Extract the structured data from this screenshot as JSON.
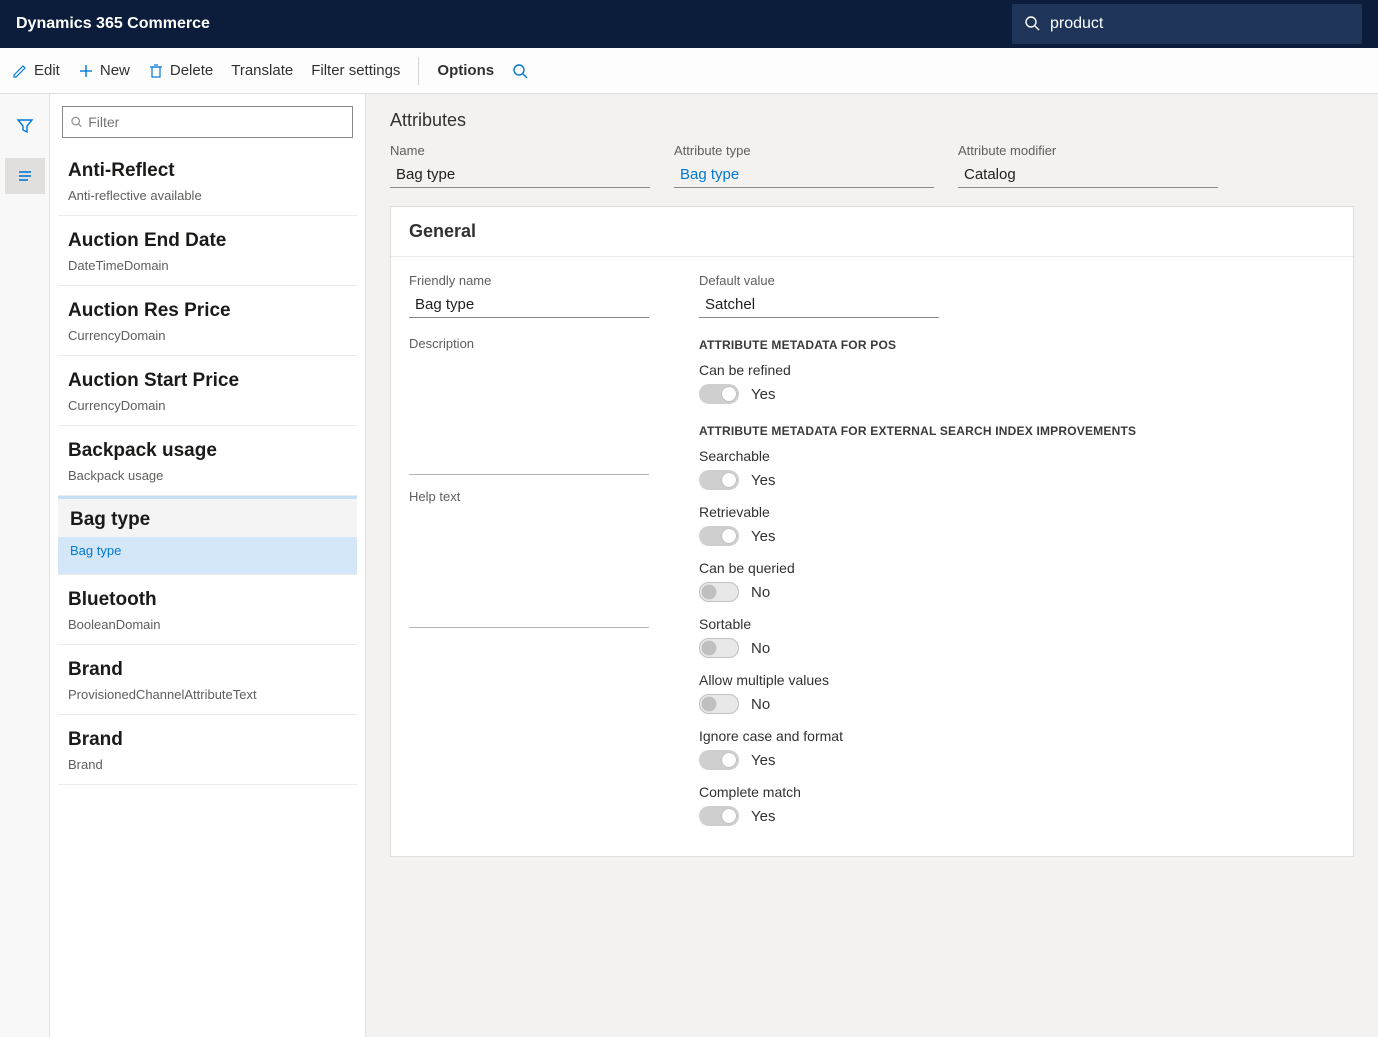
{
  "app_title": "Dynamics 365 Commerce",
  "search": {
    "value": "product"
  },
  "commands": {
    "edit": "Edit",
    "new": "New",
    "delete": "Delete",
    "translate": "Translate",
    "filter_settings": "Filter settings",
    "options": "Options"
  },
  "filter_placeholder": "Filter",
  "list_items": [
    {
      "title": "Anti-Reflect",
      "sub": "Anti-reflective available",
      "selected": false
    },
    {
      "title": "Auction End Date",
      "sub": "DateTimeDomain",
      "selected": false
    },
    {
      "title": "Auction Res Price",
      "sub": "CurrencyDomain",
      "selected": false
    },
    {
      "title": "Auction Start Price",
      "sub": "CurrencyDomain",
      "selected": false
    },
    {
      "title": "Backpack usage",
      "sub": "Backpack usage",
      "selected": false
    },
    {
      "title": "Bag type",
      "sub": "Bag type",
      "selected": true
    },
    {
      "title": "Bluetooth",
      "sub": "BooleanDomain",
      "selected": false
    },
    {
      "title": "Brand",
      "sub": "ProvisionedChannelAttributeText",
      "selected": false
    },
    {
      "title": "Brand",
      "sub": "Brand",
      "selected": false
    }
  ],
  "detail": {
    "header": "Attributes",
    "name_label": "Name",
    "name_value": "Bag type",
    "attrtype_label": "Attribute type",
    "attrtype_value": "Bag type",
    "modifier_label": "Attribute modifier",
    "modifier_value": "Catalog",
    "general_header": "General",
    "friendly_name_label": "Friendly name",
    "friendly_name_value": "Bag type",
    "description_label": "Description",
    "description_value": "",
    "helptext_label": "Help text",
    "helptext_value": "",
    "default_value_label": "Default value",
    "default_value": "Satchel",
    "pos_header": "ATTRIBUTE METADATA FOR POS",
    "ext_header": "ATTRIBUTE METADATA FOR EXTERNAL SEARCH INDEX IMPROVEMENTS",
    "toggles": {
      "can_be_refined": {
        "label": "Can be refined",
        "on": true,
        "text": "Yes"
      },
      "searchable": {
        "label": "Searchable",
        "on": true,
        "text": "Yes"
      },
      "retrievable": {
        "label": "Retrievable",
        "on": true,
        "text": "Yes"
      },
      "can_be_queried": {
        "label": "Can be queried",
        "on": false,
        "text": "No"
      },
      "sortable": {
        "label": "Sortable",
        "on": false,
        "text": "No"
      },
      "allow_multiple": {
        "label": "Allow multiple values",
        "on": false,
        "text": "No"
      },
      "ignore_case": {
        "label": "Ignore case and format",
        "on": true,
        "text": "Yes"
      },
      "complete_match": {
        "label": "Complete match",
        "on": true,
        "text": "Yes"
      }
    }
  }
}
